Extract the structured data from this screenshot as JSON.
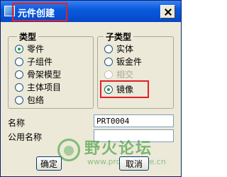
{
  "window": {
    "title": "元件创建",
    "close_icon": "close-icon"
  },
  "type_group": {
    "label": "类型",
    "options": [
      "零件",
      "子组件",
      "骨架模型",
      "主体项目",
      "包络"
    ],
    "selected": "零件"
  },
  "subtype_group": {
    "label": "子类型",
    "options": [
      "实体",
      "钣金件",
      "相交",
      "镜像"
    ],
    "disabled": [
      "相交"
    ],
    "selected": "镜像"
  },
  "fields": {
    "name_label": "名称",
    "name_value": "PRT0004",
    "common_name_label": "公用名称",
    "common_name_value": ""
  },
  "buttons": {
    "ok": "确定",
    "cancel": "取消"
  },
  "watermark": {
    "title": "野火论坛",
    "url": "www.proewildfire.cn"
  },
  "colors": {
    "highlight": "#e0202a",
    "titlebar": "#0a5bdd"
  }
}
